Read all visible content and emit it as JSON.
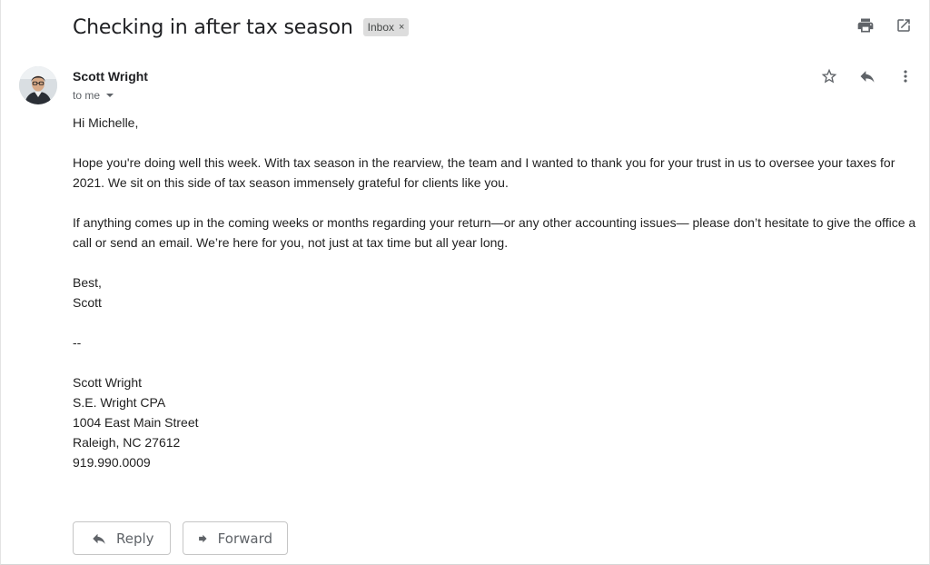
{
  "thread": {
    "subject": "Checking in after tax season",
    "label": "Inbox",
    "label_remove": "×"
  },
  "message": {
    "sender_name": "Scott Wright",
    "recipient": "to me",
    "body_lines": [
      "Hi Michelle,",
      "",
      "Hope you're doing well this week. With tax season in the rearview, the team and I wanted to thank you for your trust in us to oversee your taxes for 2021. We sit on this side of tax season immensely grateful for clients like you.",
      "",
      "If anything comes up in the coming weeks or months regarding your return—or any other accounting issues— please don’t hesitate to give the office a call or send an email. We’re here for you, not just at tax time but all year long.",
      "",
      "Best,",
      "Scott",
      "",
      "--",
      "",
      "Scott Wright",
      "S.E. Wright CPA",
      "1004 East Main Street",
      "Raleigh, NC 27612",
      "919.990.0009"
    ]
  },
  "actions": {
    "reply_label": "Reply",
    "forward_label": "Forward"
  },
  "icons": {
    "print": "print-icon",
    "open_new_window": "open-in-new-window-icon",
    "star": "star-icon",
    "reply": "reply-icon",
    "more": "more-vertical-icon",
    "forward": "forward-icon"
  },
  "colors": {
    "icon_gray": "#5f6368",
    "chip_bg": "#dddddd",
    "text": "#222222"
  }
}
